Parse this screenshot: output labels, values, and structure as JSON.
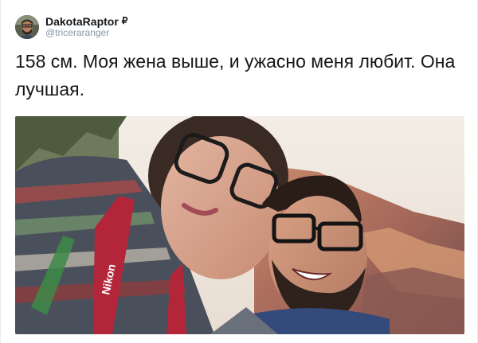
{
  "tweet": {
    "display_name": "DakotaRaptor",
    "name_glyph": "₽",
    "handle": "@triceraranger",
    "text": "158 см. Моя жена выше, и ужасно меня любит. Она лучшая.",
    "strap_brand": "Nikon"
  }
}
